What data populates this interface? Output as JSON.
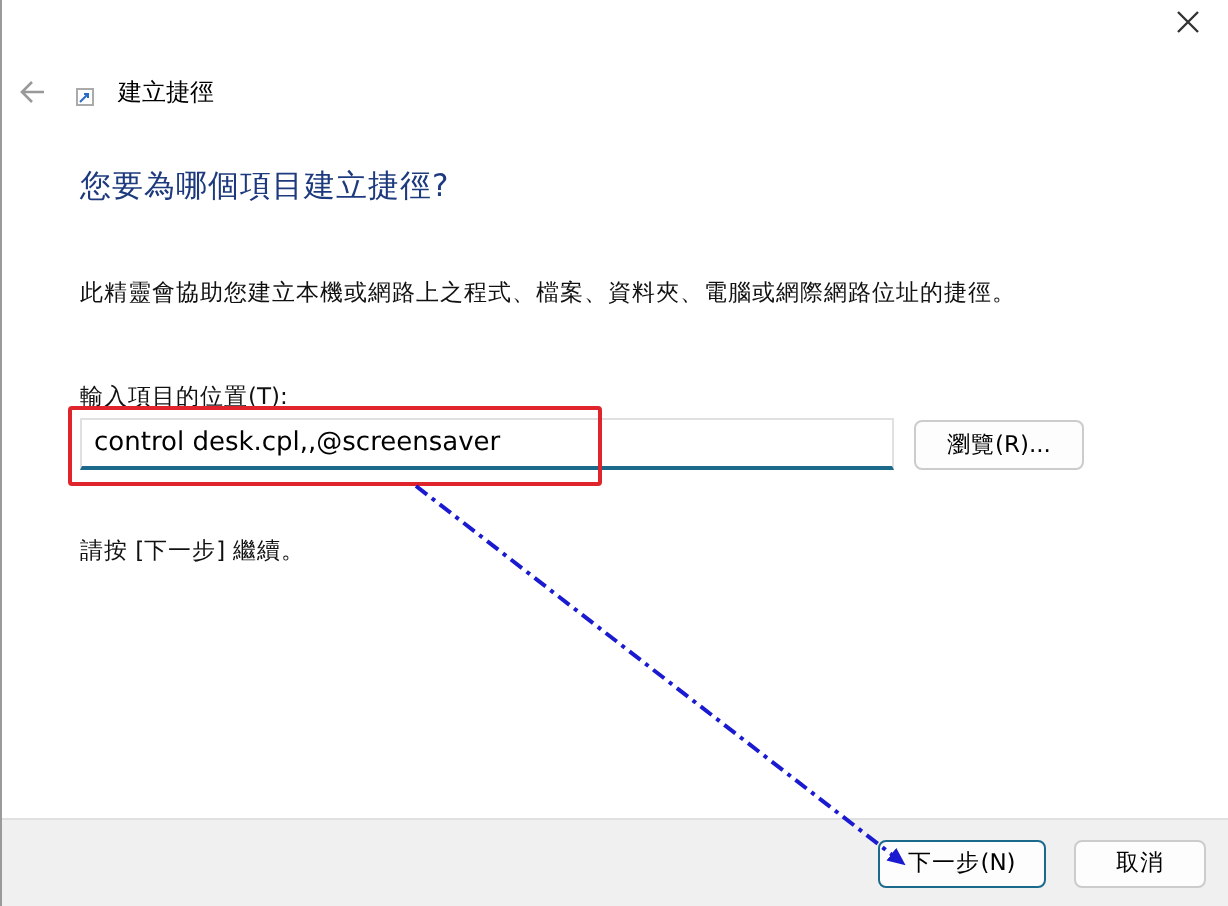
{
  "window": {
    "title": "建立捷徑"
  },
  "heading": "您要為哪個項目建立捷徑?",
  "description": "此精靈會協助您建立本機或網路上之程式、檔案、資料夾、電腦或網際網路位址的捷徑。",
  "location": {
    "label": "輸入項目的位置(T):",
    "value": "control desk.cpl,,@screensaver",
    "browse_button": "瀏覽(R)..."
  },
  "hint": "請按 [下一步] 繼續。",
  "buttons": [
    {
      "label": "下一步(N)",
      "kind": "default"
    },
    {
      "label": "取消",
      "kind": "normal"
    }
  ]
}
